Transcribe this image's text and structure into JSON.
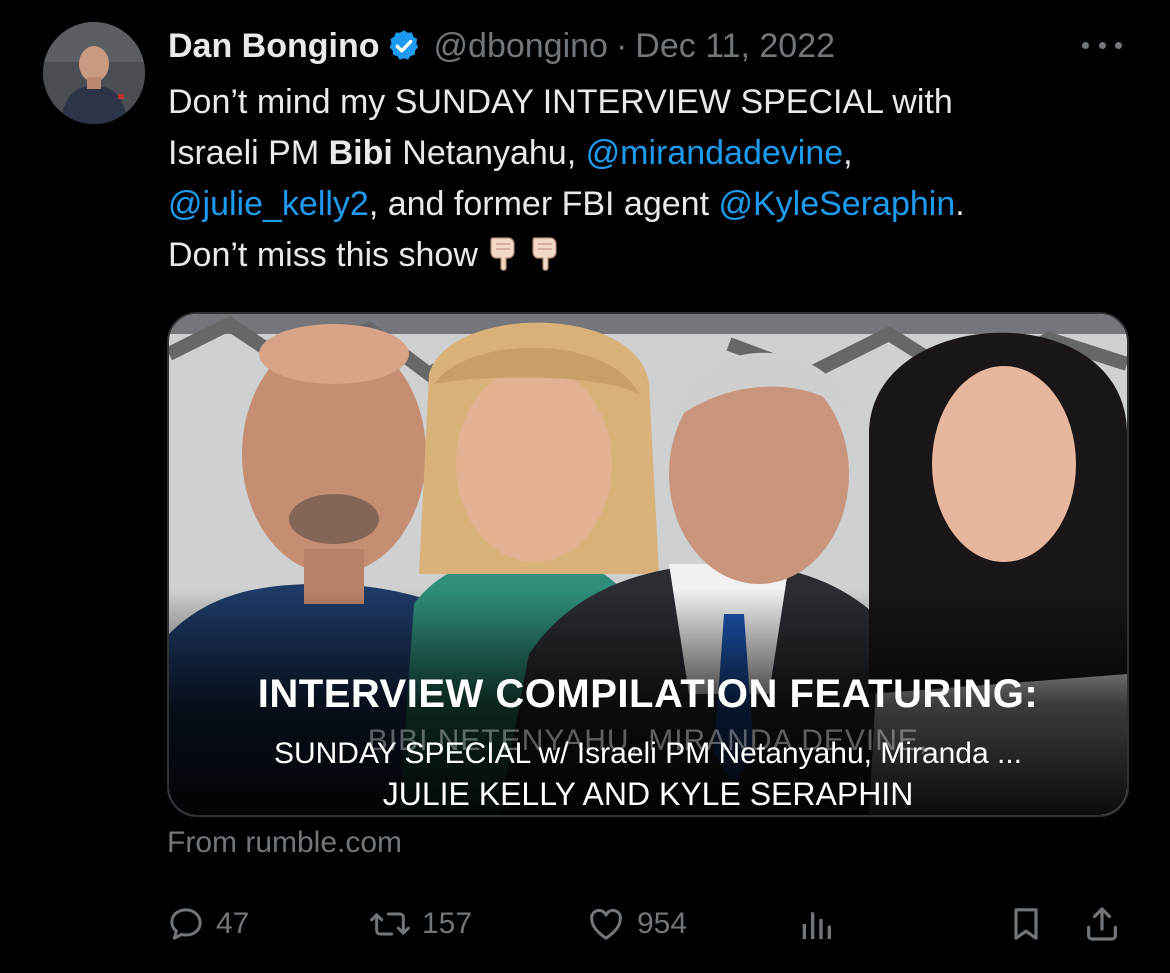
{
  "tweet": {
    "author_name": "Dan Bongino",
    "handle": "@dbongino",
    "separator": "·",
    "date": "Dec 11, 2022",
    "text": {
      "l1": "Don’t mind my SUNDAY INTERVIEW SPECIAL with",
      "l2a": "Israeli PM ",
      "l2b": "Bibi",
      "l2c": " Netanyahu, ",
      "m1": "@mirandadevine",
      "l2d": ",",
      "m2": "@julie_kelly2",
      "l3a": ", and former FBI agent ",
      "m3": "@KyleSeraphin",
      "l3b": ".",
      "l4": "Don’t miss this show"
    },
    "card": {
      "headline": "INTERVIEW COMPILATION FEATURING:",
      "ghost_text": "BIBI NETENYAHU, MIRANDA DEVINE,",
      "title": "SUNDAY SPECIAL w/ Israeli PM Netanyahu, Miranda ...",
      "subline": "JULIE KELLY AND KYLE SERAPHIN"
    },
    "source": "From rumble.com",
    "actions": {
      "replies": "47",
      "retweets": "157",
      "likes": "954"
    }
  },
  "colors": {
    "background": "#000000",
    "text": "#e7e9ea",
    "muted": "#71767b",
    "link": "#1d9bf0",
    "verified": "#1d9bf0"
  },
  "icons": [
    "verified-badge-icon",
    "more-icon",
    "pointing-down-emoji",
    "reply-icon",
    "retweet-icon",
    "like-icon",
    "views-icon",
    "bookmark-icon",
    "share-icon"
  ]
}
